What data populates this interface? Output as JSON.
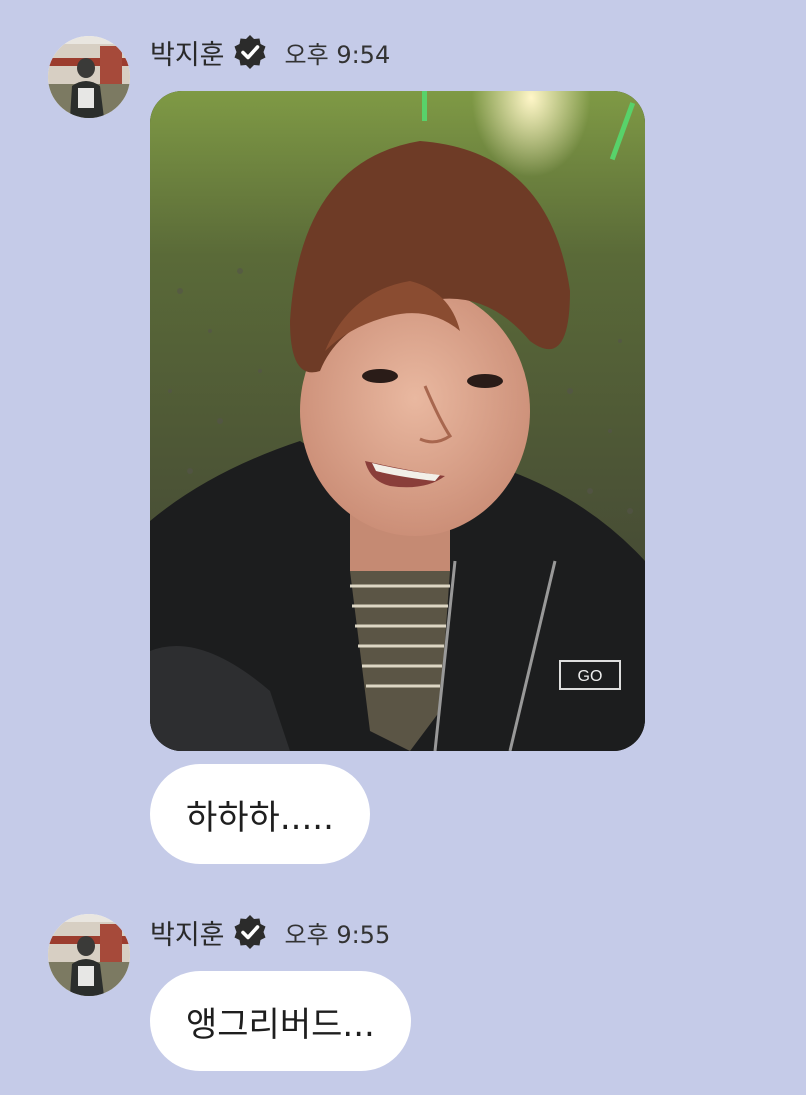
{
  "messages": [
    {
      "sender": "박지훈",
      "verified_icon": "verified-badge-icon",
      "time": "오후 9:54",
      "photo": "selfie-photo",
      "text": "하하하....."
    },
    {
      "sender": "박지훈",
      "verified_icon": "verified-badge-icon",
      "time": "오후 9:55",
      "text": "앵그리버드..."
    }
  ],
  "colors": {
    "background": "#c5cbe8",
    "bubble": "#ffffff",
    "text": "#1e1e1e",
    "badge": "#2b2b2b"
  }
}
